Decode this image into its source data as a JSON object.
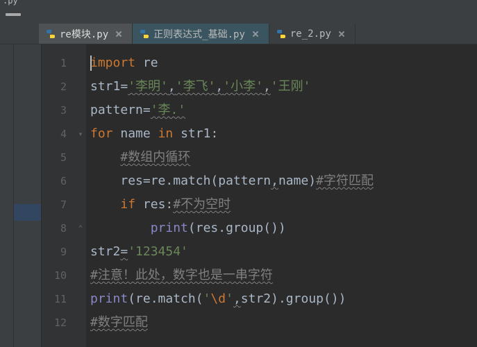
{
  "title_fragment": ".py",
  "tabs": [
    {
      "label": "re模块.py",
      "active": true,
      "special": false
    },
    {
      "label": "正则表达式_基础.py",
      "active": false,
      "special": true
    },
    {
      "label": "re_2.py",
      "active": false,
      "special": false
    }
  ],
  "line_numbers": [
    "1",
    "2",
    "3",
    "4",
    "5",
    "6",
    "7",
    "8",
    "9",
    "10",
    "11",
    "12"
  ],
  "code": {
    "l1": {
      "kw": "import",
      "mod": "re"
    },
    "l2": {
      "var": "str1",
      "op": "=",
      "s1": "'李明'",
      "c1": ",",
      "s2": "'李飞'",
      "c2": ",",
      "s3": "'小李'",
      "c3": ",",
      "s4": "'王刚'"
    },
    "l3": {
      "var": "pattern",
      "op": "=",
      "s": "'李.'"
    },
    "l4": {
      "kw1": "for",
      "name": "name",
      "kw2": "in",
      "iter": "str1",
      "colon": ":"
    },
    "l5": {
      "cmt": "#数组内循环"
    },
    "l6": {
      "res": "res",
      "op": "=",
      "call": "re.match(pattern",
      "comma": ",",
      "arg2": "name)",
      "cmt": "#字符匹配"
    },
    "l7": {
      "kw": "if",
      "cond": "res",
      "colon": ":",
      "cmt": "#不为空时"
    },
    "l8": {
      "fn": "print",
      "args": "(res.group())"
    },
    "l9": {
      "var": "str2",
      "op": "=",
      "s": "'123454'"
    },
    "l10": {
      "cmt": "#注意！此处，数字也是一串字符"
    },
    "l11": {
      "fn": "print",
      "open": "(re.match(",
      "q1": "'",
      "esc": "\\d",
      "q2": "'",
      "comma": ",",
      "arg2": "str2).group())"
    },
    "l12": {
      "cmt": "#数字匹配"
    }
  },
  "fold_marks": {
    "4": "▾",
    "8": "⌃"
  }
}
